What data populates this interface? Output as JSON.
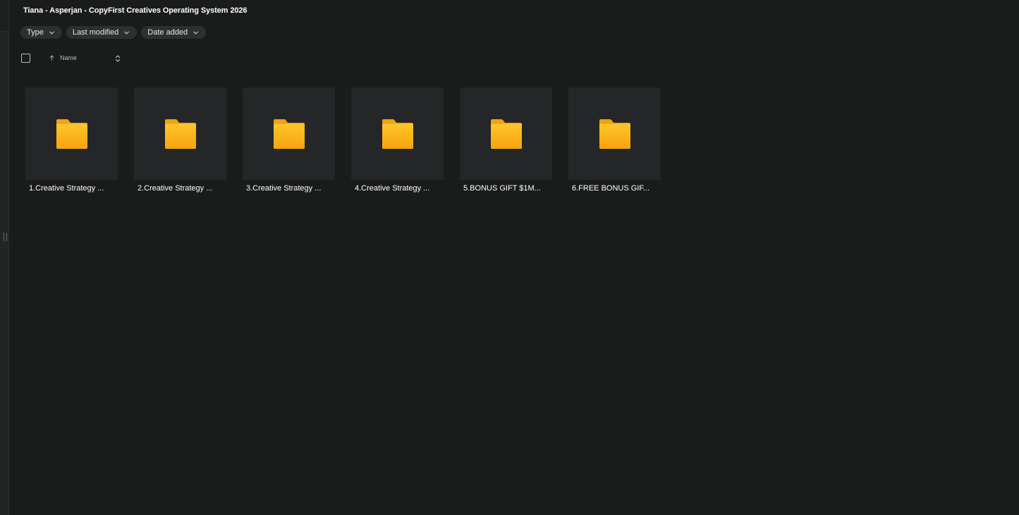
{
  "header": {
    "title": "Tiana - Asperjan - CopyFirst Creatives Operating System 2026"
  },
  "filters": [
    {
      "label": "Type",
      "icon": "chevron-down-icon"
    },
    {
      "label": "Last modified",
      "icon": "chevron-down-icon"
    },
    {
      "label": "Date added",
      "icon": "chevron-down-icon"
    }
  ],
  "sort": {
    "label": "Name",
    "direction": "ascending",
    "direction_icon": "arrow-up-icon",
    "toggle_icon": "sort-toggle-icon"
  },
  "items": [
    {
      "label": "1.Creative Strategy ...",
      "icon": "folder-icon"
    },
    {
      "label": "2.Creative Strategy ...",
      "icon": "folder-icon"
    },
    {
      "label": "3.Creative Strategy ...",
      "icon": "folder-icon"
    },
    {
      "label": "4.Creative Strategy ...",
      "icon": "folder-icon"
    },
    {
      "label": "5.BONUS GIFT $1M...",
      "icon": "folder-icon"
    },
    {
      "label": "6.FREE BONUS GIF...",
      "icon": "folder-icon"
    }
  ],
  "colors": {
    "background": "#1a1b1b",
    "tile": "#252628",
    "chip": "#2e2f31",
    "folder_top": "#ffc62b",
    "folder_bottom": "#f7a30f"
  }
}
